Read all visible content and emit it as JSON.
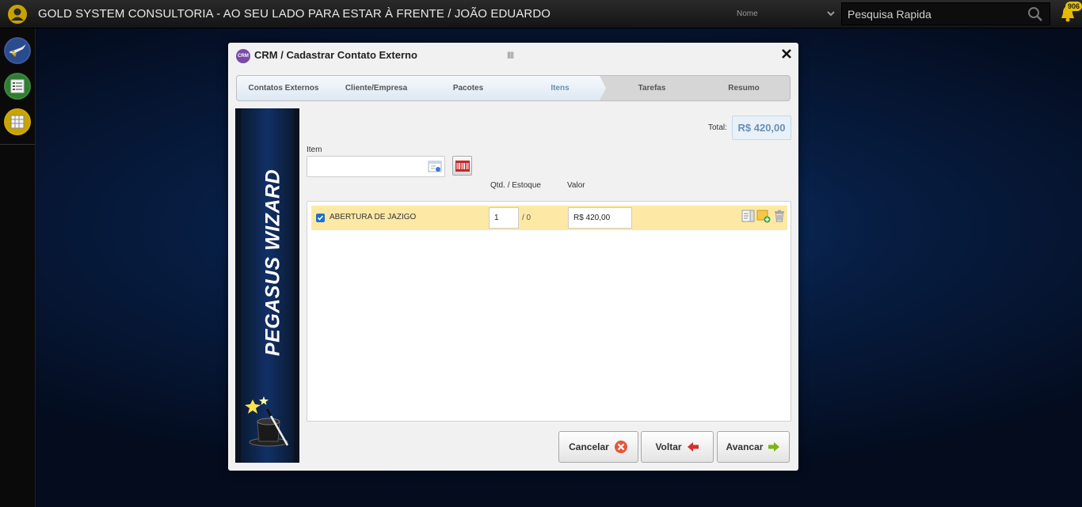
{
  "header": {
    "title": "GOLD SYSTEM CONSULTORIA - AO SEU LADO PARA ESTAR À FRENTE / JOÃO EDUARDO",
    "search_type": "Nome",
    "search_placeholder": "Pesquisa Rapida",
    "notifications_count": "906"
  },
  "sidebar": {
    "items": [
      {
        "icon": "launch-icon",
        "color": "#2b4b8f"
      },
      {
        "icon": "list-icon",
        "color": "#2e7d32"
      },
      {
        "icon": "grid-icon",
        "color": "#c9a300"
      }
    ]
  },
  "dialog": {
    "module": "CRM",
    "separator": "/",
    "title": "Cadastrar Contato Externo",
    "grip": "||||||",
    "steps": [
      {
        "label": "Contatos Externos",
        "done": true
      },
      {
        "label": "Cliente/Empresa",
        "done": true
      },
      {
        "label": "Pacotes",
        "done": true
      },
      {
        "label": "Itens",
        "done": true,
        "active": true
      },
      {
        "label": "Tarefas",
        "done": false
      },
      {
        "label": "Resumo",
        "done": false
      }
    ],
    "wizard_banner": "PEGASUS WIZARD",
    "total_label": "Total:",
    "total_value": "R$ 420,00",
    "item_label": "Item",
    "item_value": "",
    "columns": {
      "qty": "Qtd.",
      "separator": "/",
      "stock": "Estoque",
      "value": "Valor"
    },
    "items": [
      {
        "checked": true,
        "name": "ABERTURA DE JAZIGO",
        "qty": "1",
        "stock": "/ 0",
        "value": "R$ 420,00"
      }
    ],
    "buttons": {
      "cancel": "Cancelar",
      "back": "Voltar",
      "next": "Avancar"
    }
  }
}
